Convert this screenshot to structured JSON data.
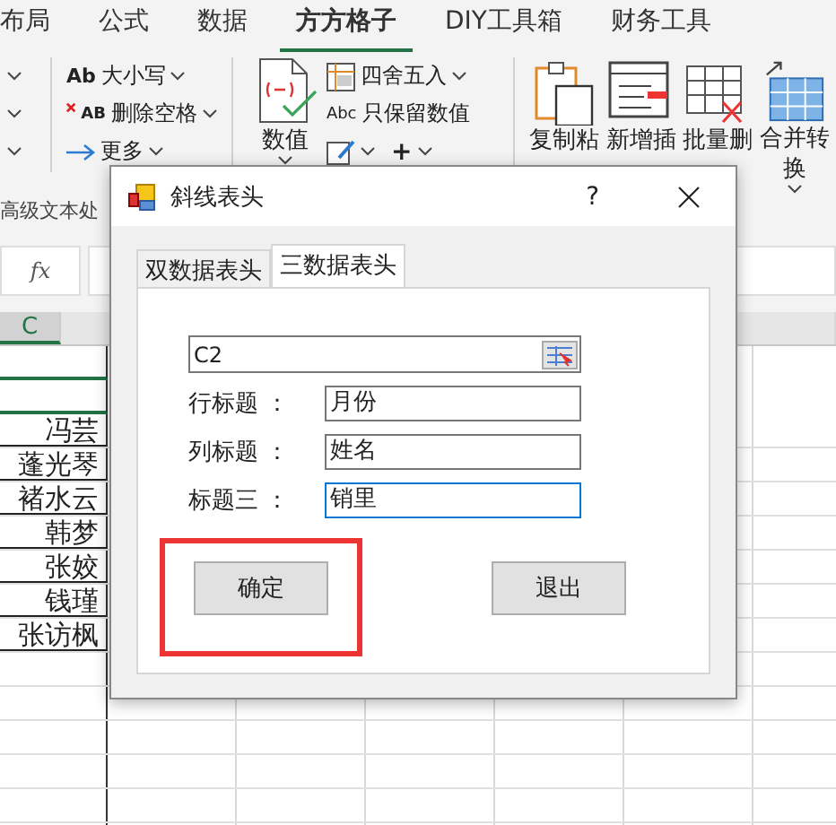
{
  "ribbon": {
    "tabs": [
      {
        "label": "布局",
        "selected": false
      },
      {
        "label": "公式",
        "selected": false
      },
      {
        "label": "数据",
        "selected": false
      },
      {
        "label": "方方格子",
        "selected": true
      },
      {
        "label": "DIY工具箱",
        "selected": false
      },
      {
        "label": "财务工具",
        "selected": false
      }
    ],
    "text_tools": [
      {
        "kind": "ab",
        "prefix": "Ab",
        "label": "大小写"
      },
      {
        "kind": "clear",
        "prefix": "AB",
        "label": "删除空格"
      },
      {
        "kind": "arrow",
        "label": "更多"
      }
    ],
    "group_label": "高级文本处",
    "number_button": {
      "label": "数值"
    },
    "number_tools": [
      {
        "kind": "round",
        "label": "四舍五入",
        "dropdown": true
      },
      {
        "kind": "abc",
        "prefix": "Abc",
        "label": "只保留数值",
        "dropdown": false
      }
    ],
    "number_extra": {
      "plus": "+"
    },
    "big_buttons": [
      {
        "kind": "paste",
        "lines": [
          "复制粘"
        ]
      },
      {
        "kind": "insert",
        "lines": [
          "新增插"
        ]
      },
      {
        "kind": "delete",
        "lines": [
          "批量删"
        ]
      },
      {
        "kind": "merge",
        "lines": [
          "合并转",
          "换"
        ]
      }
    ]
  },
  "formula_bar": {
    "fx": "fx"
  },
  "sheet": {
    "column": "C",
    "rows": [
      {
        "selected": true
      },
      {
        "selected": true
      },
      {
        "value": "冯芸",
        "selected": false
      },
      {
        "value": "蓬光琴",
        "selected": false
      },
      {
        "value": "褚水云",
        "selected": false
      },
      {
        "value": "韩梦",
        "selected": false
      },
      {
        "value": "张姣",
        "selected": false
      },
      {
        "value": "钱瑾",
        "selected": false
      },
      {
        "value": "张访枫",
        "selected": false
      }
    ]
  },
  "dialog": {
    "title": "斜线表头",
    "help": "?",
    "tabs": [
      {
        "label": "双数据表头",
        "selected": false
      },
      {
        "label": "三数据表头",
        "selected": true
      }
    ],
    "range_field": {
      "value": "C2"
    },
    "fields": [
      {
        "label": "行标题 ：",
        "value": "月份",
        "focused": false
      },
      {
        "label": "列标题 ：",
        "value": "姓名",
        "focused": false
      },
      {
        "label": "标题三 ：",
        "value": "销里",
        "focused": true
      }
    ],
    "buttons": [
      {
        "label": "确定",
        "highlighted": true
      },
      {
        "label": "退出",
        "highlighted": false
      }
    ]
  }
}
